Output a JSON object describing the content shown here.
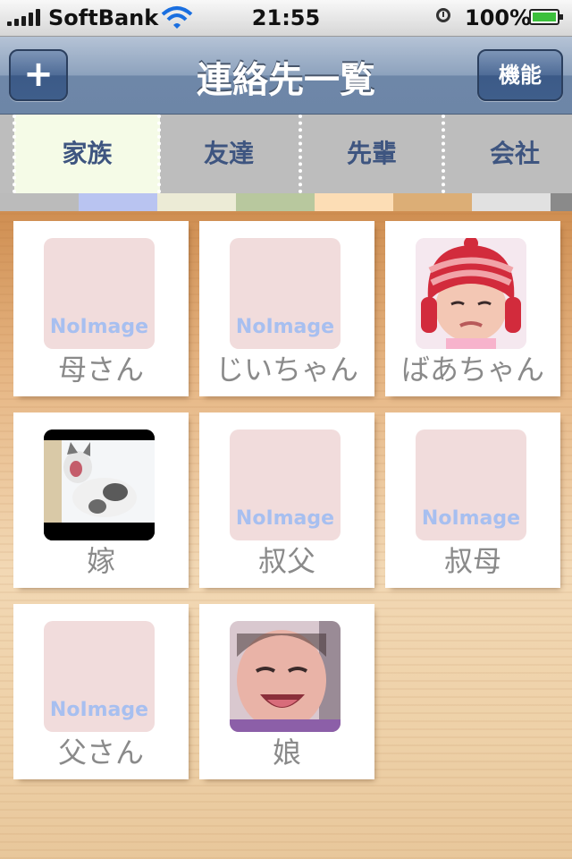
{
  "status": {
    "carrier": "SoftBank",
    "time": "21:55",
    "battery": "100%"
  },
  "nav": {
    "title": "連絡先一覧",
    "add_label": "+",
    "function_label": "機能"
  },
  "tabs": [
    {
      "label": "家族",
      "active": true
    },
    {
      "label": "友達",
      "active": false
    },
    {
      "label": "先輩",
      "active": false
    },
    {
      "label": "会社",
      "active": false
    }
  ],
  "color_strip": [
    "#bbbbbb",
    "#b9c4f1",
    "#ecebd6",
    "#b8c89e",
    "#fcddb5",
    "#dcae76",
    "#e1e1e1",
    "#8a8a8a"
  ],
  "contacts": [
    {
      "name": "母さん",
      "image": "no-image",
      "placeholder": "NoImage"
    },
    {
      "name": "じいちゃん",
      "image": "no-image",
      "placeholder": "NoImage"
    },
    {
      "name": "ばあちゃん",
      "image": "baby-in-red-hat-photo"
    },
    {
      "name": "嫁",
      "image": "cat-yawning-photo"
    },
    {
      "name": "叔父",
      "image": "no-image",
      "placeholder": "NoImage"
    },
    {
      "name": "叔母",
      "image": "no-image",
      "placeholder": "NoImage"
    },
    {
      "name": "父さん",
      "image": "no-image",
      "placeholder": "NoImage"
    },
    {
      "name": "娘",
      "image": "smiling-baby-photo"
    }
  ]
}
